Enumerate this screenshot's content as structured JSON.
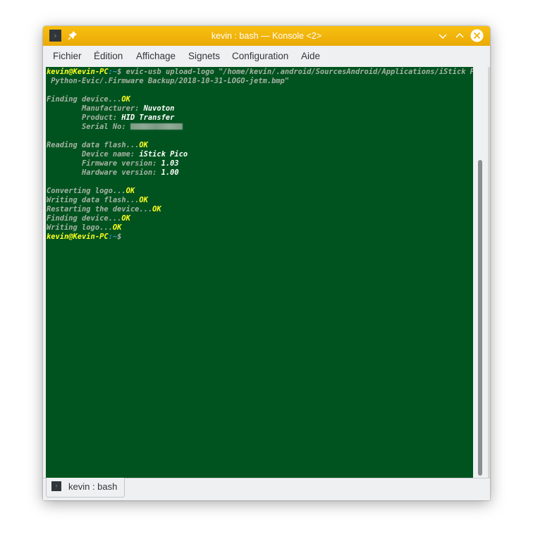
{
  "window": {
    "title": "kevin : bash — Konsole <2>",
    "icon": "terminal-icon",
    "controls": [
      "minimize-icon",
      "maximize-icon",
      "close-icon"
    ],
    "accent": "#f3b40b"
  },
  "menu": {
    "items": [
      "Fichier",
      "Édition",
      "Affichage",
      "Signets",
      "Configuration",
      "Aide"
    ]
  },
  "terminal": {
    "background": "#00531f",
    "prompt": {
      "user_host": "kevin@Kevin-PC",
      "sep": ":",
      "path": "~",
      "symbol": "$"
    },
    "command_line_1": " evic-usb upload-logo \"/home/kevin/.android/SourcesAndroid/Applications/iStick Pico",
    "command_line_2": " Python-Evic/.Firmware Backup/2018-10-31-LOGO-jetm.bmp\"",
    "finding_device": "Finding device...",
    "ok": "OK",
    "manufacturer_label": "        Manufacturer: ",
    "manufacturer_value": "Nuvoton",
    "product_label": "        Product: ",
    "product_value": "HID Transfer",
    "serial_label": "        Serial No: ",
    "reading_flash": "Reading data flash...",
    "device_name_label": "        Device name: ",
    "device_name_value": "iStick Pico",
    "firmware_label": "        Firmware version: ",
    "firmware_value": "1.03",
    "hardware_label": "        Hardware version: ",
    "hardware_value": "1.00",
    "converting_logo": "Converting logo...",
    "writing_flash": "Writing data flash...",
    "restarting": "Restarting the device...",
    "finding_device_2": "Finding device...",
    "writing_logo": "Writing logo..."
  },
  "tabs": [
    {
      "label": "kevin : bash",
      "icon": "terminal-icon",
      "active": true
    }
  ]
}
